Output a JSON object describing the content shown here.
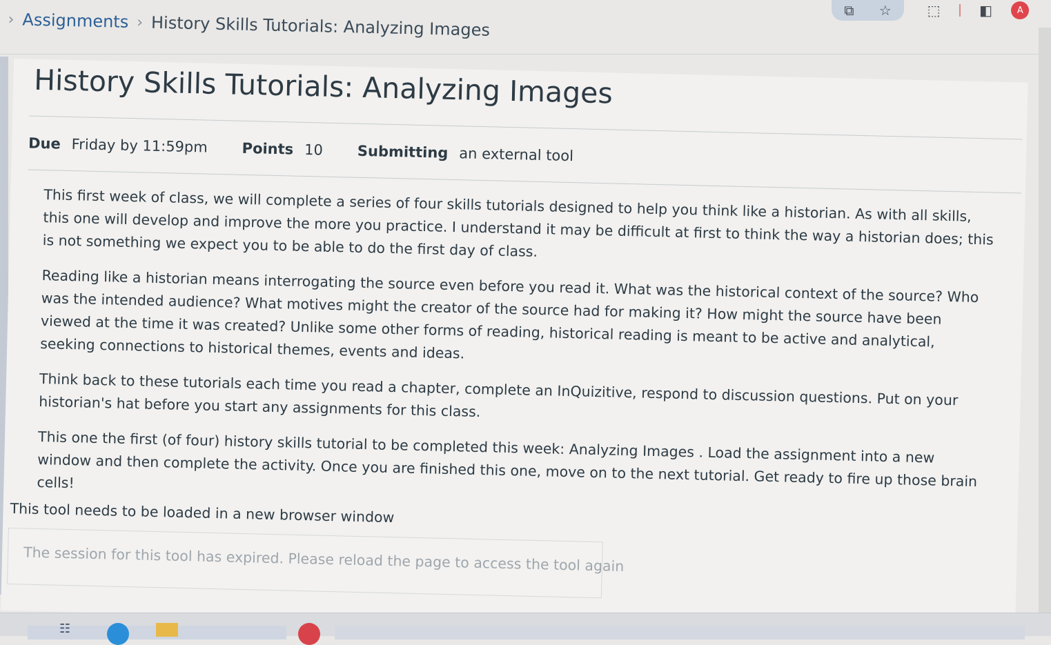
{
  "breadcrumb": {
    "items": [
      "Assignments",
      "History Skills Tutorials: Analyzing Images"
    ]
  },
  "page": {
    "title": "History Skills Tutorials: Analyzing Images"
  },
  "meta": {
    "due_label": "Due",
    "due_value": "Friday by 11:59pm",
    "points_label": "Points",
    "points_value": "10",
    "submitting_label": "Submitting",
    "submitting_value": "an external tool"
  },
  "description": {
    "paragraphs": [
      "This first week of class, we will complete a series of four skills tutorials designed to help you think like a historian. As with all skills, this one will develop and improve the more you practice.  I understand it may be difficult at first to think the way a historian does; this is not something we expect you to be able to do the first day of class.",
      "Reading like a historian means interrogating the source even before you read it. What was the historical context of the source? Who was the intended audience? What motives might the creator of the source had for making it? How might the source have been viewed at the time it was created? Unlike some other forms of reading, historical reading is meant to be active and analytical, seeking connections to historical themes, events and ideas.",
      "Think back to these tutorials each time you read a chapter, complete an InQuizitive, respond to discussion questions. Put on your historian's hat before you start any assignments for this class.",
      "This one the first (of four) history skills tutorial to be completed this week: Analyzing Images . Load the assignment into a new window and then complete the activity. Once you are finished this one, move on to the next tutorial.  Get ready to fire up those brain cells!"
    ]
  },
  "tool": {
    "note": "This tool needs to be loaded in a new browser window",
    "expired_message": "The session for this tool has expired. Please reload the page to access the tool again"
  },
  "chrome": {
    "avatar_letter": "A",
    "icons": [
      "cast-icon",
      "star-icon",
      "extension-icon",
      "side-panel-icon"
    ]
  }
}
